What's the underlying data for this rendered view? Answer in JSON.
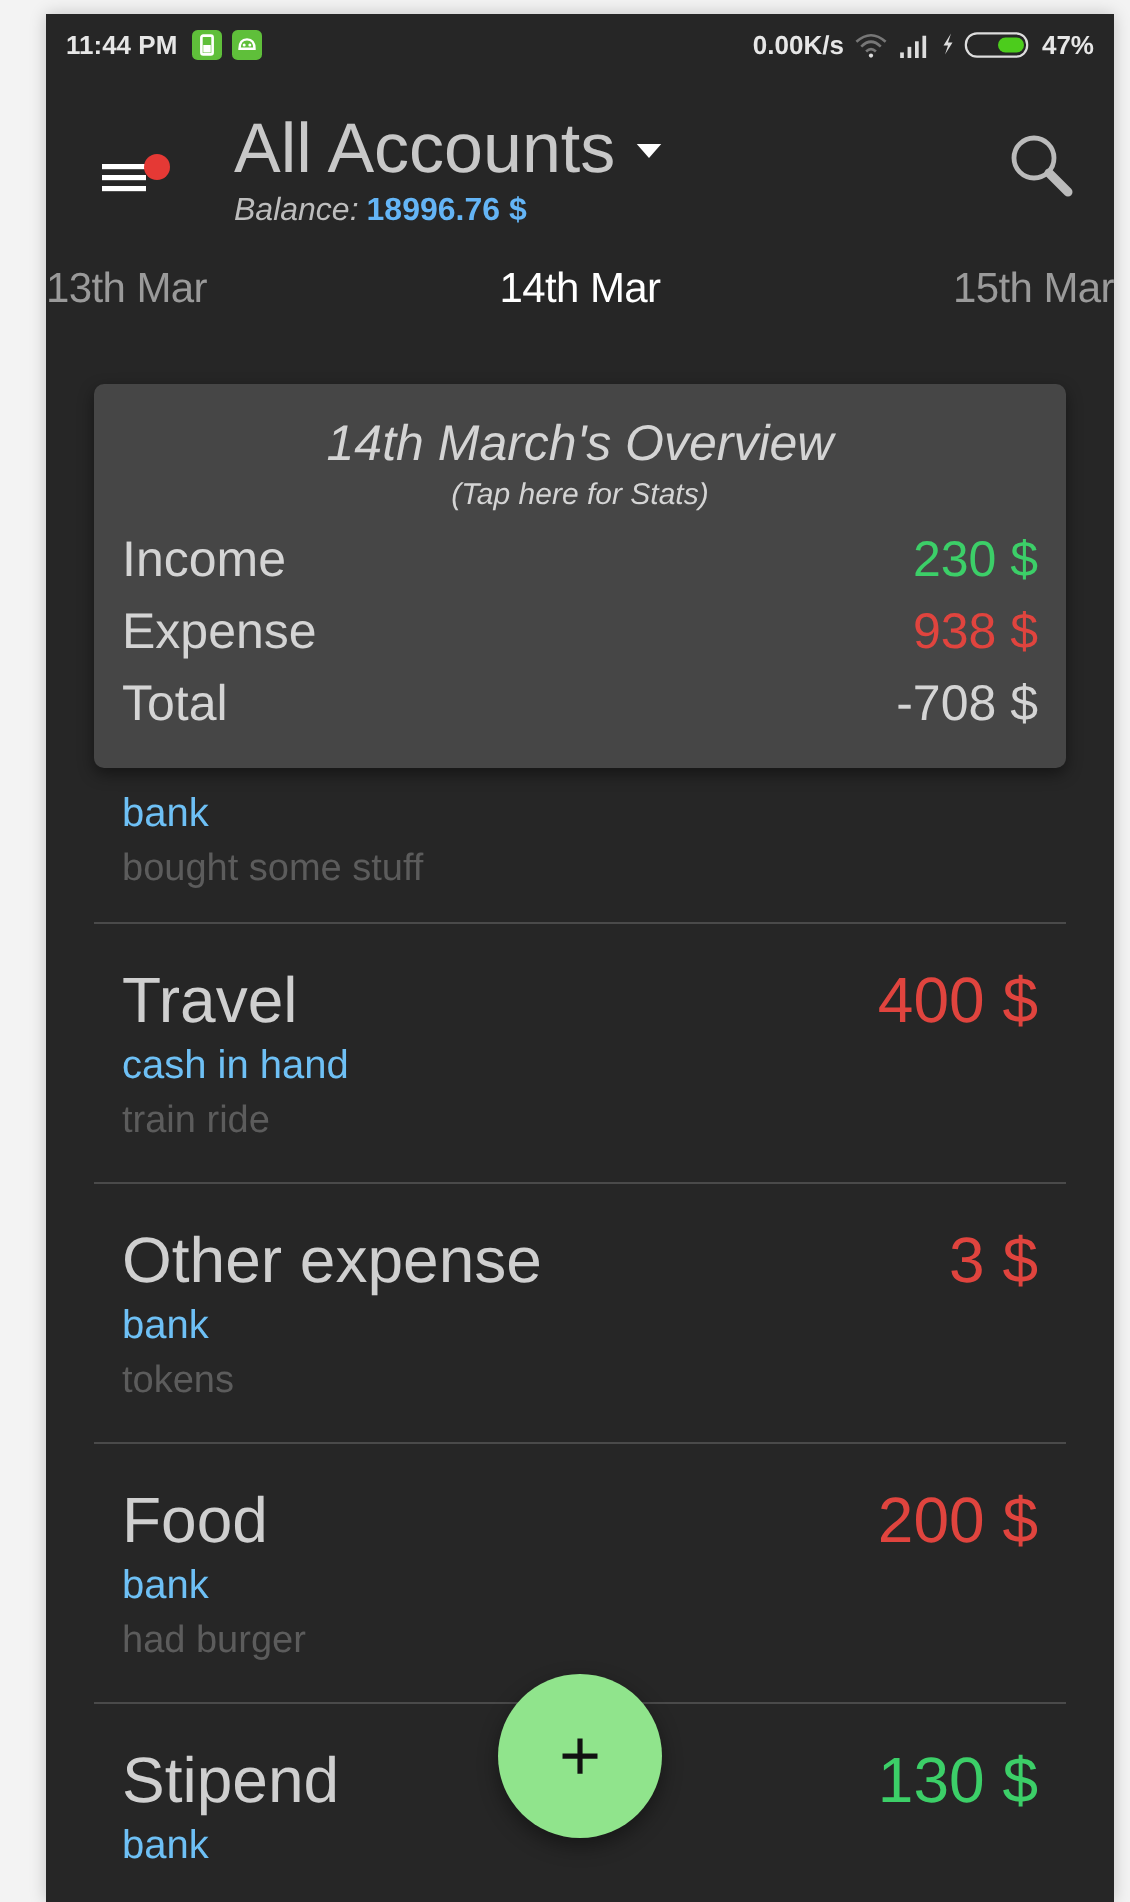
{
  "status_bar": {
    "time": "11:44 PM",
    "speed": "0.00K/s",
    "battery": "47%"
  },
  "header": {
    "title": "All Accounts",
    "balance_label": "Balance:",
    "balance": "18996.76 $"
  },
  "dates": [
    {
      "label": "13th Mar",
      "selected": false
    },
    {
      "label": "14th Mar",
      "selected": true
    },
    {
      "label": "15th Mar",
      "selected": false
    }
  ],
  "overview": {
    "title": "14th March's Overview",
    "subtitle": "(Tap here for Stats)",
    "lines": [
      {
        "label": "Income",
        "value": "230 $",
        "kind": "income"
      },
      {
        "label": "Expense",
        "value": "938 $",
        "kind": "expense"
      },
      {
        "label": "Total",
        "value": "-708 $",
        "kind": "total"
      }
    ]
  },
  "transactions": [
    {
      "account": "bank",
      "note": "bought some stuff"
    },
    {
      "title": "Travel",
      "amount": "400 $",
      "kind": "expense",
      "account": "cash in hand",
      "note": "train ride"
    },
    {
      "title": "Other expense",
      "amount": "3 $",
      "kind": "expense",
      "account": "bank",
      "note": "tokens"
    },
    {
      "title": "Food",
      "amount": "200 $",
      "kind": "expense",
      "account": "bank",
      "note": "had burger"
    },
    {
      "title": "Stipend",
      "amount": "130 $",
      "kind": "income",
      "account": "bank"
    }
  ],
  "fab": {
    "label": "+"
  }
}
